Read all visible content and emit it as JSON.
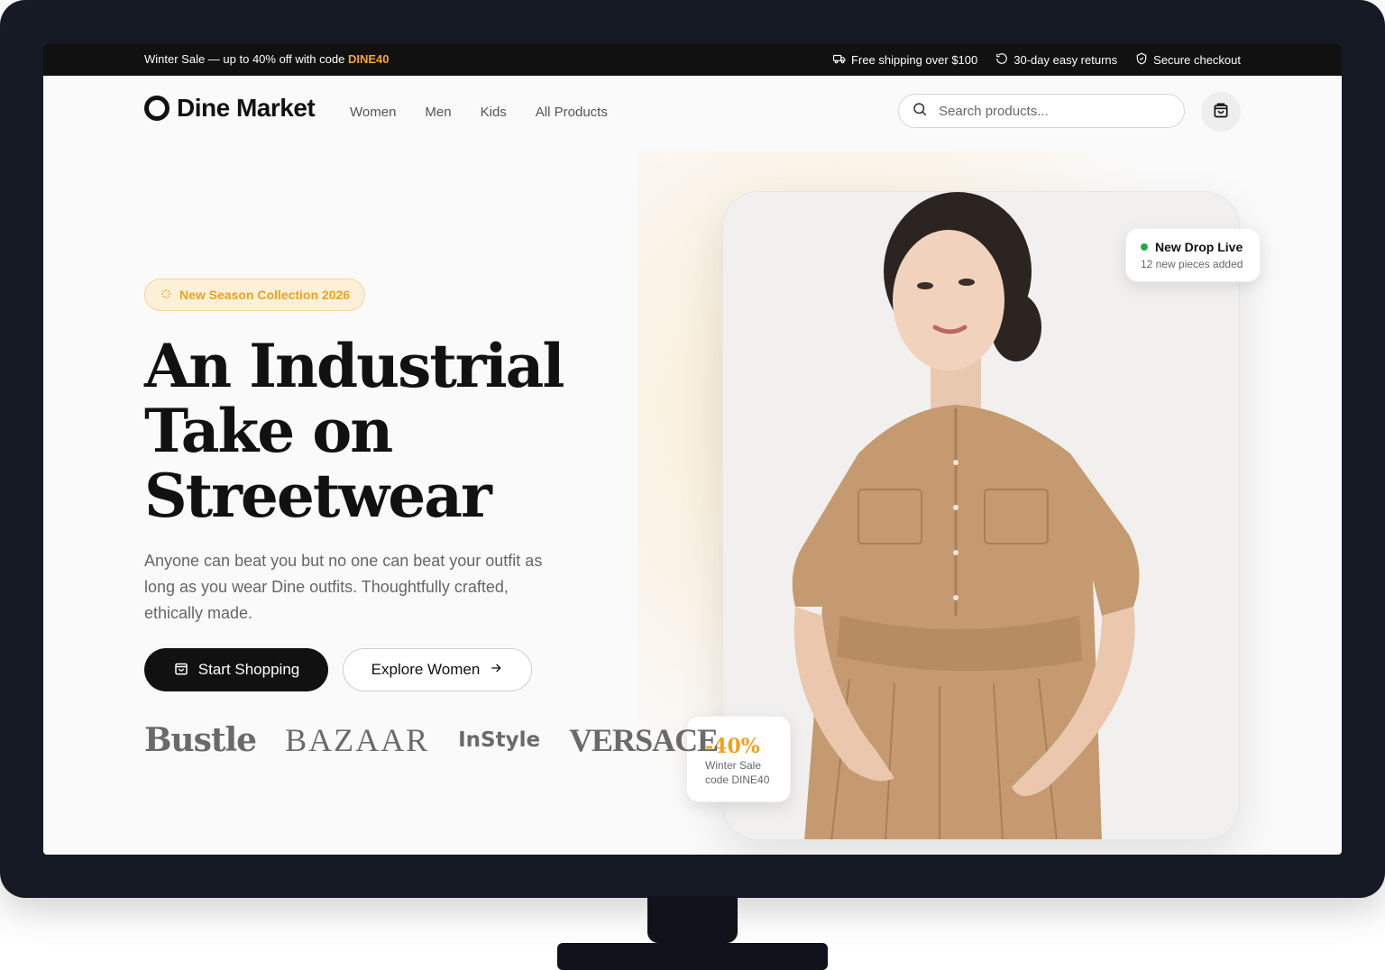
{
  "announcement": {
    "sale_text": "Winter Sale — up to 40% off with code",
    "sale_code": "DINE40",
    "perks": [
      {
        "icon": "truck-icon",
        "label": "Free shipping over $100"
      },
      {
        "icon": "refresh-icon",
        "label": "30-day easy returns"
      },
      {
        "icon": "shield-icon",
        "label": "Secure checkout"
      }
    ]
  },
  "header": {
    "logo": "Dine Market",
    "nav": [
      "Women",
      "Men",
      "Kids",
      "All Products"
    ],
    "search_placeholder": "Search products...",
    "cart_icon": "shopping-bag-icon"
  },
  "hero": {
    "badge": "New Season Collection 2026",
    "headline": [
      "An Industrial",
      "Take on",
      "Streetwear"
    ],
    "description": "Anyone can beat you but no one can beat your outfit as long as you wear Dine outfits. Thoughtfully crafted, ethically made.",
    "primary_button": "Start Shopping",
    "secondary_button": "Explore Women",
    "brands": [
      "Bustle",
      "BAZAAR",
      "InStyle",
      "VERSACE"
    ]
  },
  "cards": {
    "drop_title": "New Drop Live",
    "drop_sub": "12 new pieces added",
    "sale_percent": "-40%",
    "sale_line1": "Winter Sale",
    "sale_line2": "code DINE40"
  },
  "colors": {
    "accent": "#f0a21c",
    "highlight": "#f7c66b",
    "dark": "#111111",
    "status_green": "#22a74a"
  }
}
